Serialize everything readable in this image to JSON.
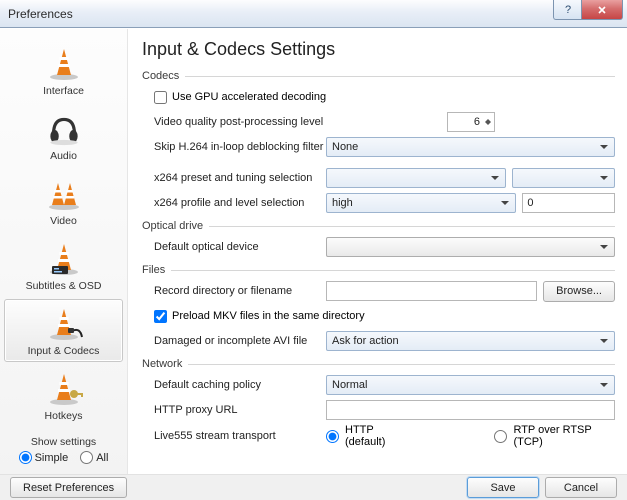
{
  "window": {
    "title": "Preferences"
  },
  "sidebar": {
    "items": [
      {
        "label": "Interface"
      },
      {
        "label": "Audio"
      },
      {
        "label": "Video"
      },
      {
        "label": "Subtitles & OSD"
      },
      {
        "label": "Input & Codecs"
      },
      {
        "label": "Hotkeys"
      }
    ],
    "show_settings": {
      "title": "Show settings",
      "simple": "Simple",
      "all": "All"
    }
  },
  "page": {
    "title": "Input & Codecs Settings",
    "groups": {
      "codecs": {
        "title": "Codecs",
        "gpu_decoding": "Use GPU accelerated decoding",
        "video_quality_pp": "Video quality post-processing level",
        "video_quality_pp_value": "6",
        "skip_h264": "Skip H.264 in-loop deblocking filter",
        "skip_h264_value": "None",
        "x264_preset": "x264 preset and tuning selection",
        "x264_preset_value": "",
        "x264_tuning_value": "",
        "x264_profile": "x264 profile and level selection",
        "x264_profile_value": "high",
        "x264_level_value": "0"
      },
      "optical": {
        "title": "Optical drive",
        "default_device": "Default optical device",
        "default_device_value": ""
      },
      "files": {
        "title": "Files",
        "record_dir": "Record directory or filename",
        "record_dir_value": "",
        "browse": "Browse...",
        "preload_mkv": "Preload MKV files in the same directory",
        "damaged_avi": "Damaged or incomplete AVI file",
        "damaged_avi_value": "Ask for action"
      },
      "network": {
        "title": "Network",
        "caching": "Default caching policy",
        "caching_value": "Normal",
        "http_proxy": "HTTP proxy URL",
        "http_proxy_value": "",
        "live555": "Live555 stream transport",
        "live555_http": "HTTP (default)",
        "live555_rtp": "RTP over RTSP (TCP)"
      }
    }
  },
  "footer": {
    "reset": "Reset Preferences",
    "save": "Save",
    "cancel": "Cancel"
  }
}
